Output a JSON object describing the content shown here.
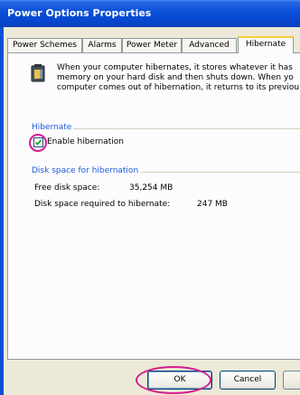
{
  "window": {
    "title": "Power Options Properties"
  },
  "tabs": [
    {
      "label": "Power Schemes"
    },
    {
      "label": "Alarms"
    },
    {
      "label": "Power Meter"
    },
    {
      "label": "Advanced"
    },
    {
      "label": "Hibernate",
      "active": true
    }
  ],
  "hibernate_tab": {
    "icon": "battery-icon",
    "description_lines": [
      "When your computer hibernates, it stores whatever it has",
      "memory on your hard disk and then shuts down. When yo",
      "computer comes out of hibernation, it returns to its previou"
    ],
    "hibernate_group": {
      "title": "Hibernate",
      "checkbox_label": "Enable hibernation",
      "checked": true
    },
    "disk_space_group": {
      "title": "Disk space for hibernation",
      "free_label": "Free disk space:",
      "free_value": "35,254 MB",
      "required_label": "Disk space required to hibernate:",
      "required_value": "247 MB"
    }
  },
  "buttons": {
    "ok": "OK",
    "cancel": "Cancel"
  },
  "colors": {
    "highlight": "#d61c8c",
    "titlebar": "#0a4fd8",
    "group_title": "#1b5ad8"
  }
}
